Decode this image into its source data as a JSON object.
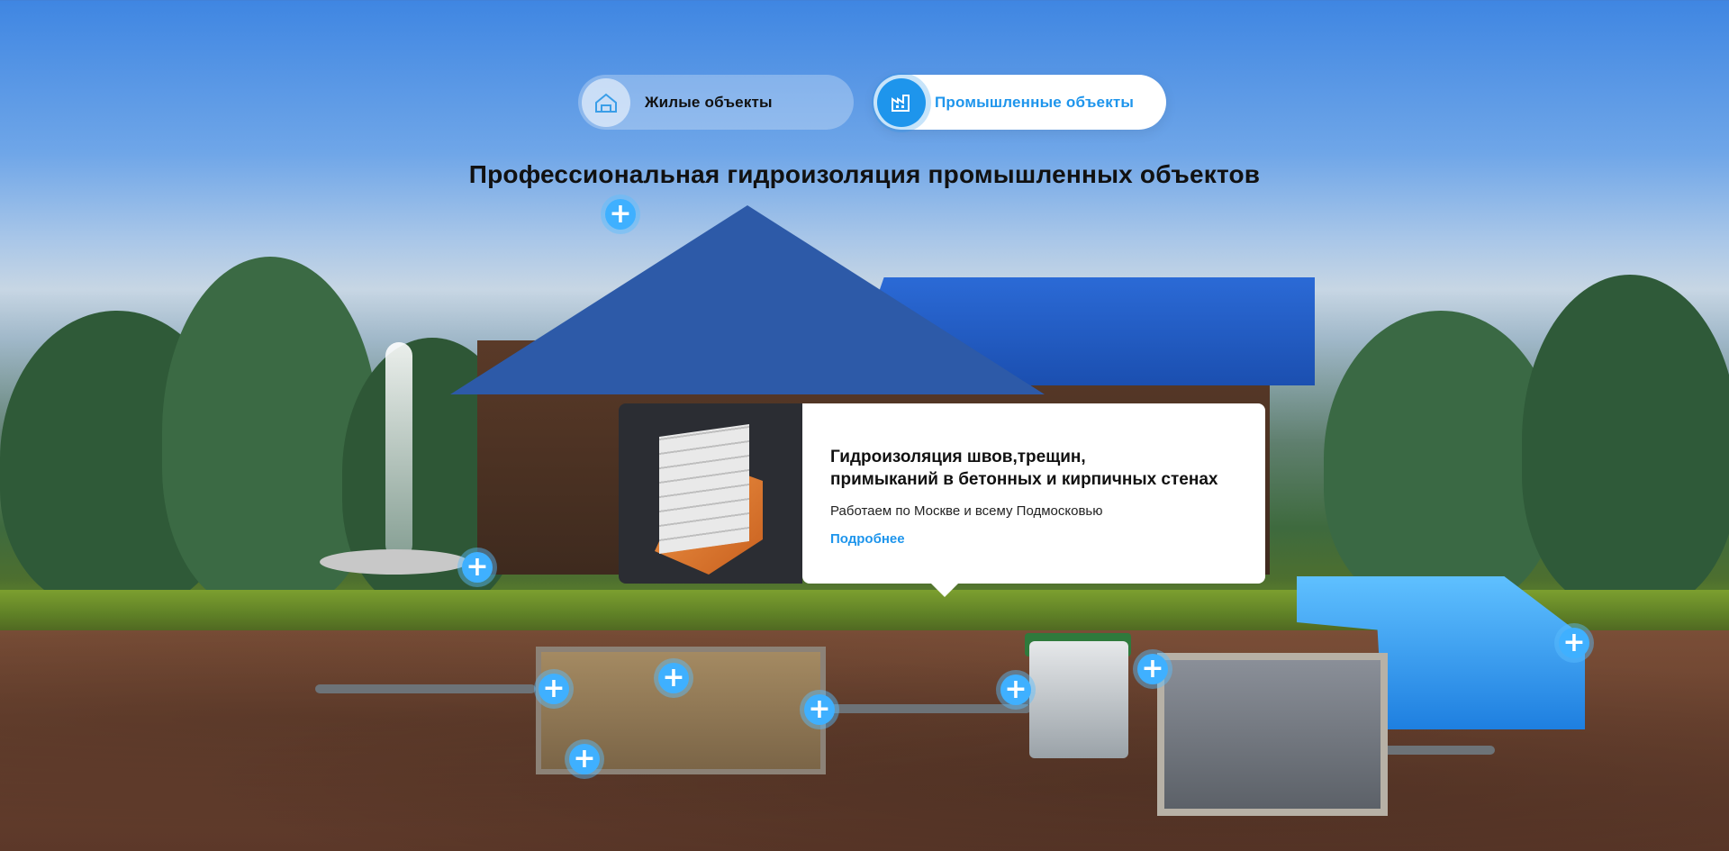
{
  "tabs": [
    {
      "label": "Жилые объекты",
      "icon": "house-icon",
      "active": false
    },
    {
      "label": "Промышленные объекты",
      "icon": "factory-icon",
      "active": true
    }
  ],
  "page_title": "Профессиональная гидроизоляция промышленных объектов",
  "popup": {
    "title_line1": "Гидроизоляция швов,трещин,",
    "title_line2": "примыканий в бетонных и кирпичных стенах",
    "text": "Работаем по Москве и всему Подмосковью",
    "link": "Подробнее",
    "image_icon": "wall-layers-icon"
  },
  "hotspot_symbol": "+",
  "colors": {
    "accent": "#1e95ec",
    "hotspot": "#3fb0ff",
    "title": "#111111"
  }
}
